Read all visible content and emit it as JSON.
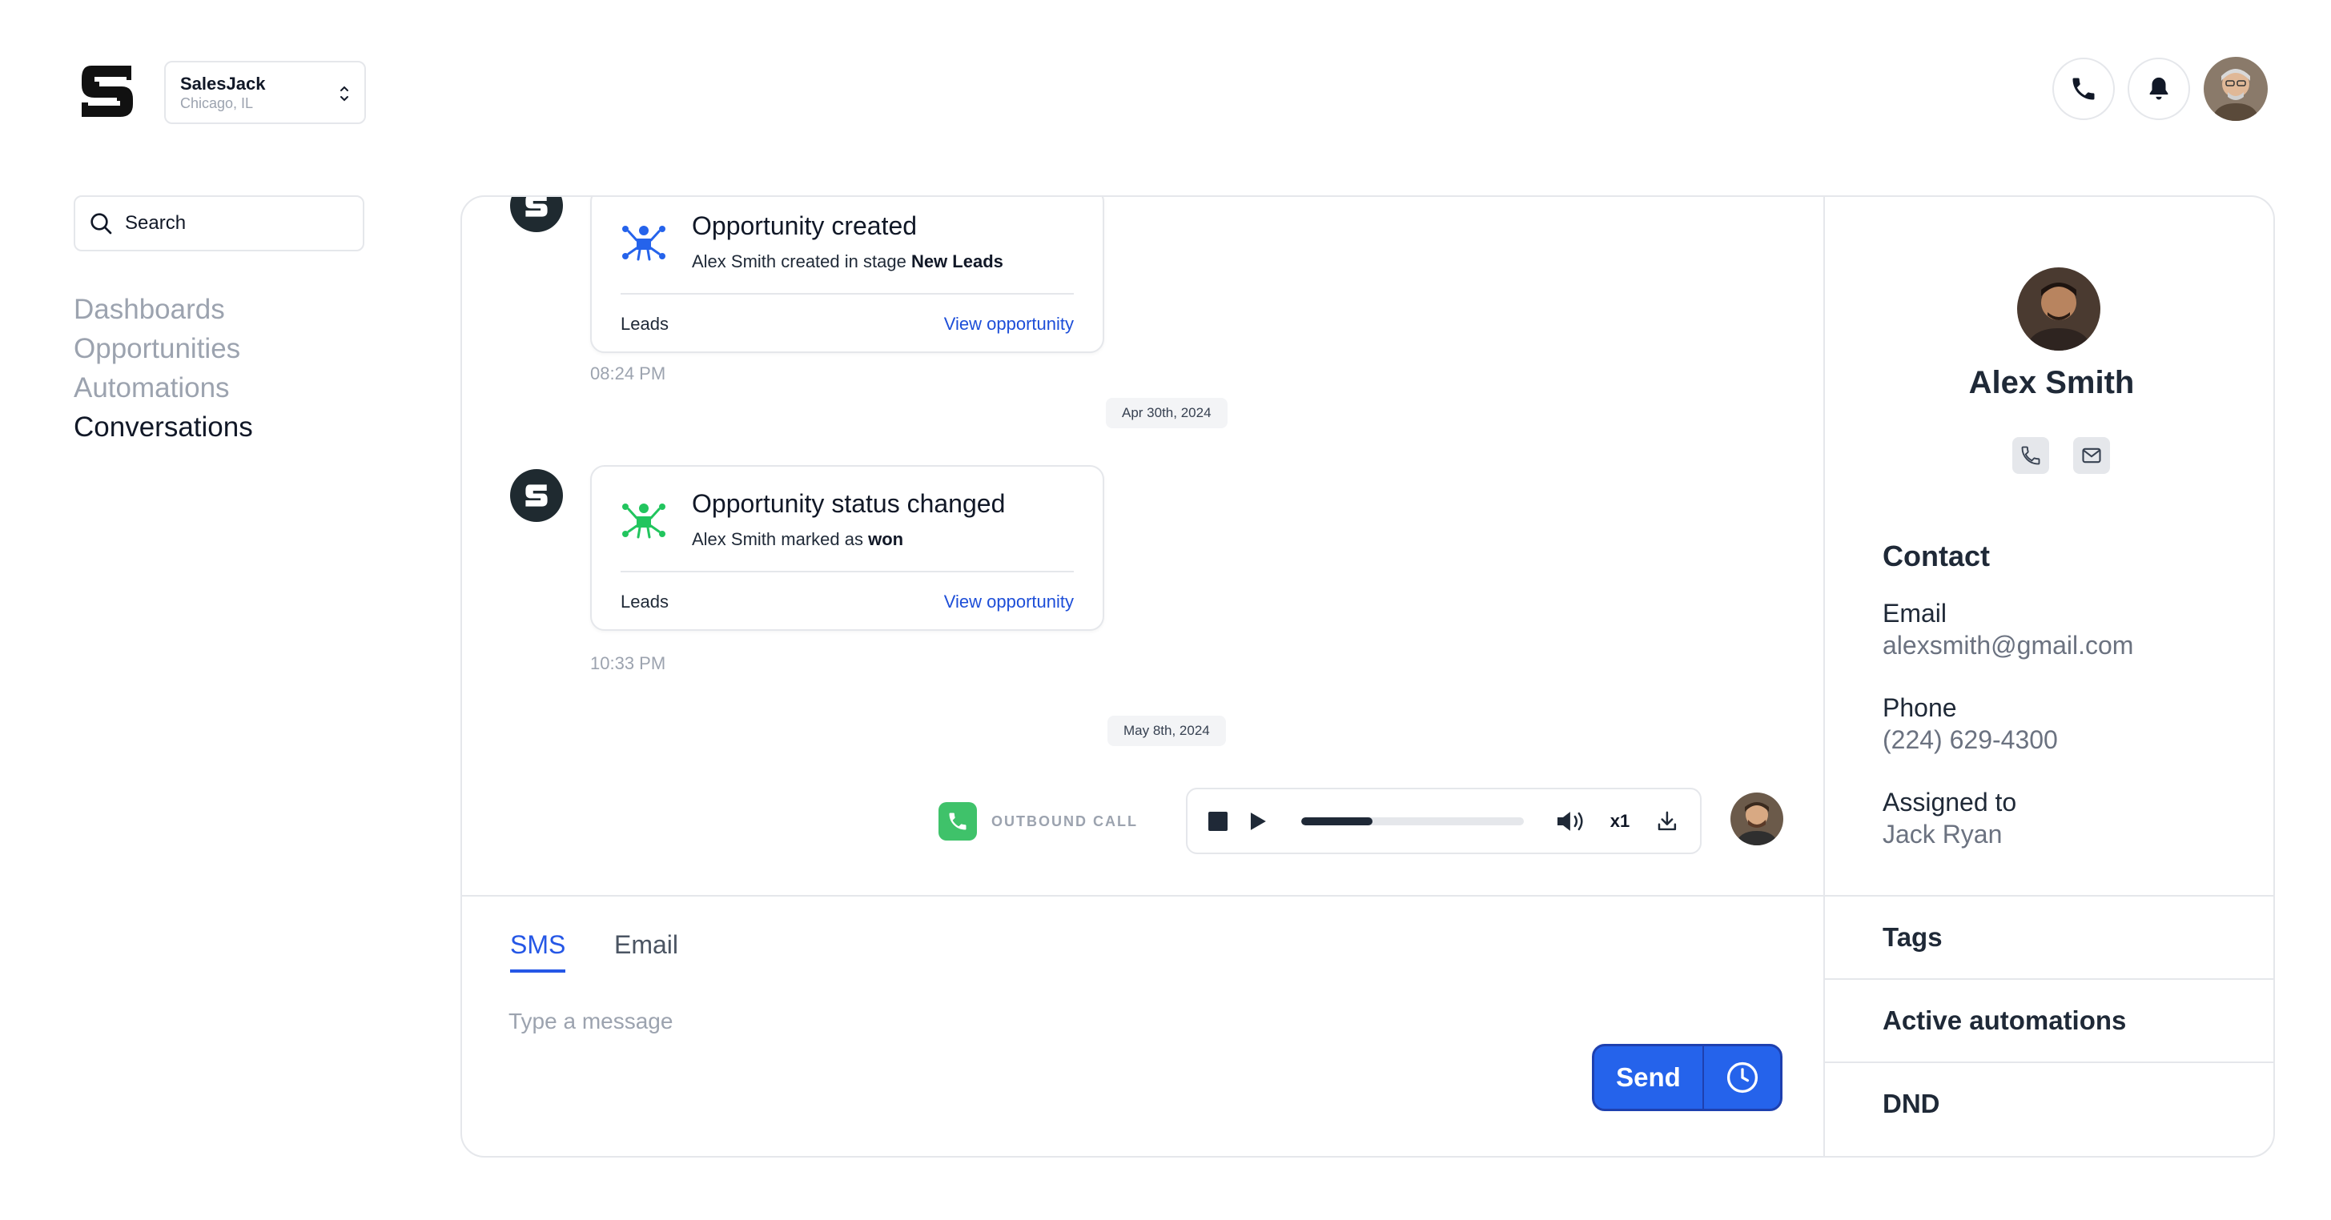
{
  "workspace": {
    "name": "SalesJack",
    "location": "Chicago, IL"
  },
  "search": {
    "placeholder": "Search"
  },
  "nav": {
    "items": [
      {
        "label": "Dashboards"
      },
      {
        "label": "Opportunities"
      },
      {
        "label": "Automations"
      },
      {
        "label": "Conversations",
        "active": true
      }
    ]
  },
  "timeline": {
    "card1": {
      "title": "Opportunity created",
      "sub_prefix": "Alex Smith created in stage",
      "sub_bold": "New Leads",
      "footer_left": "Leads",
      "footer_link": "View opportunity",
      "time": "08:24 PM",
      "icon_color": "#2563eb"
    },
    "date1": "Apr 30th, 2024",
    "card2": {
      "title": "Opportunity status changed",
      "sub_prefix": "Alex Smith marked as",
      "sub_bold": "won",
      "footer_left": "Leads",
      "footer_link": "View opportunity",
      "time": "10:33 PM",
      "icon_color": "#22c55e"
    },
    "date2": "May 8th, 2024",
    "call": {
      "label": "OUTBOUND CALL",
      "speed": "x1",
      "progress": 0.32
    }
  },
  "composer": {
    "tabs": [
      {
        "label": "SMS",
        "active": true
      },
      {
        "label": "Email"
      }
    ],
    "placeholder": "Type a message",
    "send_label": "Send"
  },
  "contact": {
    "name": "Alex Smith",
    "section_title": "Contact",
    "email_label": "Email",
    "email": "alexsmith@gmail.com",
    "phone_label": "Phone",
    "phone": "(224) 629-4300",
    "assigned_label": "Assigned to",
    "assigned": "Jack Ryan",
    "rows": [
      {
        "label": "Tags"
      },
      {
        "label": "Active automations"
      },
      {
        "label": "DND"
      }
    ]
  },
  "colors": {
    "accent": "#2563eb",
    "call_green": "#3fc26a",
    "muted": "#9ca3af"
  }
}
